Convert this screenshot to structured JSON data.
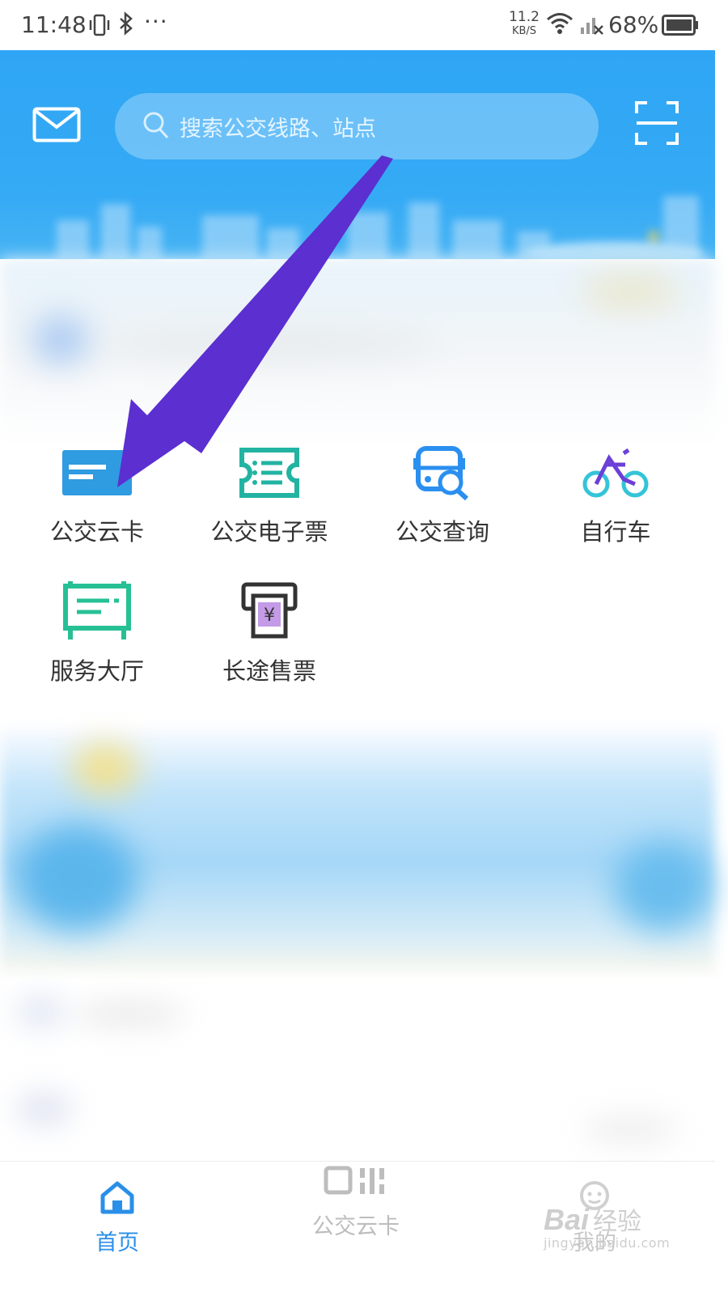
{
  "status_bar": {
    "time": "11:48",
    "more": "···",
    "net_speed_value": "11.2",
    "net_speed_unit": "KB/S",
    "battery": "68%"
  },
  "header": {
    "search_placeholder": "搜索公交线路、站点"
  },
  "services": [
    {
      "label": "公交云卡",
      "icon": "bus-card-icon",
      "color": "#2f9be0"
    },
    {
      "label": "公交电子票",
      "icon": "e-ticket-icon",
      "color": "#23b3a2"
    },
    {
      "label": "公交查询",
      "icon": "bus-search-icon",
      "color": "#2a8fef"
    },
    {
      "label": "自行车",
      "icon": "bicycle-icon",
      "color": "#34c4d8"
    },
    {
      "label": "服务大厅",
      "icon": "service-hall-icon",
      "color": "#27c095"
    },
    {
      "label": "长途售票",
      "icon": "long-distance-ticket-icon",
      "color": "#333333"
    }
  ],
  "tabbar": {
    "items": [
      {
        "label": "首页",
        "icon": "home-icon",
        "active": true
      },
      {
        "label": "公交云卡",
        "icon": "qr-code-icon",
        "active": false
      },
      {
        "label": "我的",
        "icon": "profile-icon",
        "active": false
      }
    ]
  },
  "watermark": {
    "brand": "Bai",
    "text": "经验",
    "url": "jingyan.baidu.com"
  },
  "colors": {
    "header_blue": "#2fa6f5",
    "active_tab": "#2a8fe8",
    "inactive_tab": "#bdbdbd",
    "annotation_arrow": "#5b2fd0"
  }
}
